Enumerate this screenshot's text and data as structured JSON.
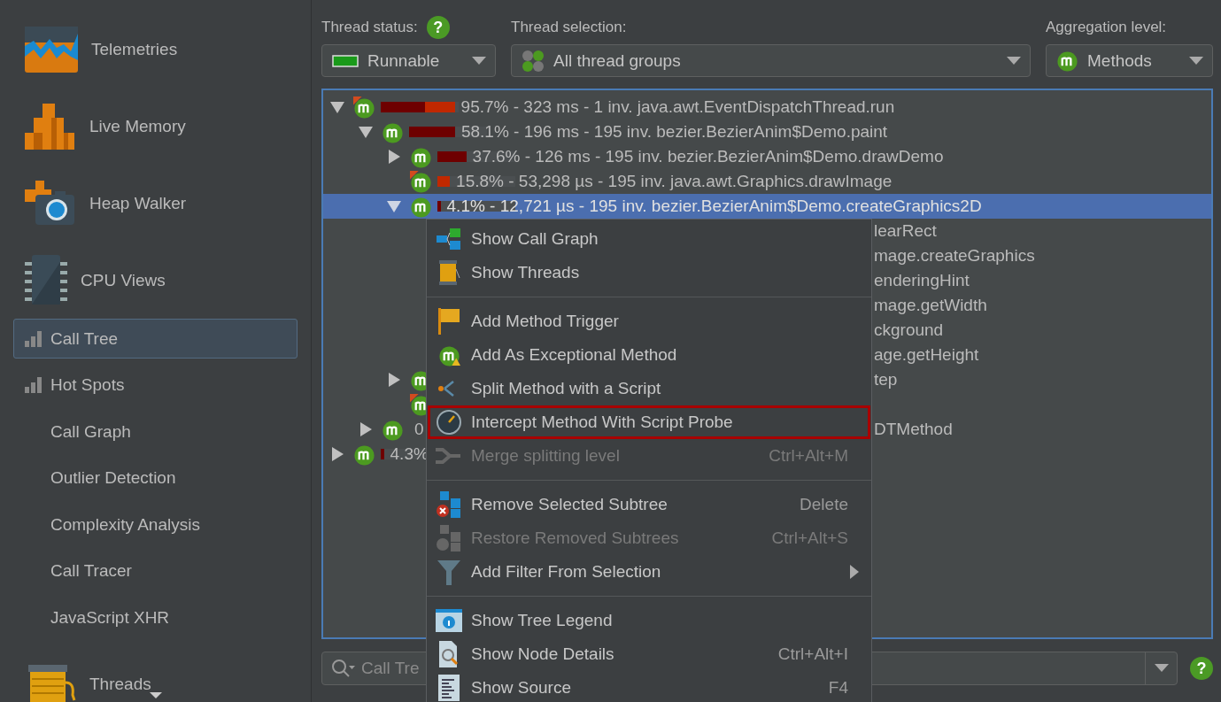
{
  "sidebar": {
    "items": [
      {
        "kind": "section",
        "label": "Telemetries",
        "selected": false
      },
      {
        "kind": "section",
        "label": "Live Memory",
        "selected": false
      },
      {
        "kind": "section",
        "label": "Heap Walker",
        "selected": false
      },
      {
        "kind": "section",
        "label": "CPU Views",
        "selected": false
      },
      {
        "kind": "view",
        "label": "Call Tree",
        "selected": true
      },
      {
        "kind": "view",
        "label": "Hot Spots",
        "selected": false
      },
      {
        "kind": "subview",
        "label": "Call Graph",
        "selected": false
      },
      {
        "kind": "subview",
        "label": "Outlier Detection",
        "selected": false
      },
      {
        "kind": "subview",
        "label": "Complexity Analysis",
        "selected": false
      },
      {
        "kind": "subview",
        "label": "Call Tracer",
        "selected": false
      },
      {
        "kind": "subview",
        "label": "JavaScript XHR",
        "selected": false
      },
      {
        "kind": "section",
        "label": "Threads",
        "selected": false
      }
    ]
  },
  "toolbar": {
    "controls": [
      {
        "label": "Thread status:",
        "help": "?",
        "value": "Runnable"
      },
      {
        "label": "Thread selection:",
        "value": "All thread groups"
      },
      {
        "label": "Aggregation level:",
        "value": "Methods"
      }
    ]
  },
  "tree": {
    "rows": [
      {
        "kind": "node",
        "expanded": true,
        "flagged": true,
        "bar": [
          {
            "level": 0.57,
            "color": "#6e0000"
          },
          {
            "level": 0.38,
            "color": "#c02800"
          }
        ],
        "text": "95.7% - 323 ms - 1 inv. java.awt.EventDispatchThread.run",
        "selected": false,
        "children": [
          {
            "kind": "node",
            "expanded": true,
            "flagged": false,
            "bar": [
              {
                "level": 0.59,
                "color": "#6e0000"
              }
            ],
            "text": "58.1% - 196 ms - 195 inv. bezier.BezierAnim$Demo.paint",
            "selected": false,
            "children": [
              {
                "kind": "node",
                "expanded": false,
                "flagged": false,
                "bar": [
                  {
                    "level": 0.37,
                    "color": "#6e0000"
                  }
                ],
                "text": "37.6% - 126 ms - 195 inv. bezier.BezierAnim$Demo.drawDemo",
                "selected": false
              },
              {
                "kind": "node",
                "flagged": true,
                "bar": [
                  {
                    "level": 0.16,
                    "color": "#c02800"
                  }
                ],
                "text": "15.8% - 53,298 µs - 195 inv. java.awt.Graphics.drawImage",
                "selected": false
              },
              {
                "kind": "node",
                "expanded": true,
                "flagged": false,
                "bar": [
                  {
                    "level": 0.04,
                    "color": "#6e0000"
                  }
                ],
                "text": "4.1% - 12,721 µs - 195 inv. bezier.BezierAnim$Demo.createGraphics2D",
                "selected": true,
                "children": [
                  {
                    "kind": "fragment",
                    "tail": "learRect"
                  },
                  {
                    "kind": "fragment",
                    "tail": "mage.createGraphics"
                  },
                  {
                    "kind": "fragment",
                    "tail": "enderingHint"
                  },
                  {
                    "kind": "fragment",
                    "tail": "mage.getWidth"
                  },
                  {
                    "kind": "fragment",
                    "tail": "ckground"
                  },
                  {
                    "kind": "fragment",
                    "tail": "age.getHeight"
                  }
                ]
              },
              {
                "kind": "node",
                "expanded": false,
                "flagged": false,
                "tail": "tep",
                "selected": false
              },
              {
                "kind": "node",
                "flagged": true,
                "selected": false
              }
            ]
          },
          {
            "kind": "node",
            "expanded": false,
            "flagged": false,
            "text": "0",
            "tail": "DTMethod",
            "selected": false
          }
        ]
      },
      {
        "kind": "node",
        "expanded": false,
        "flagged": false,
        "bar": [
          {
            "level": 0.04,
            "color": "#6e0000"
          }
        ],
        "text": "4.3%",
        "selected": false
      }
    ]
  },
  "search": {
    "placeholder": "Call Tre",
    "help": "?"
  },
  "context_menu": {
    "sections": [
      [
        {
          "label": "Show Call Graph",
          "disabled": false,
          "highlighted": false
        },
        {
          "label": "Show Threads",
          "disabled": false,
          "highlighted": false
        }
      ],
      [
        {
          "label": "Add Method Trigger",
          "disabled": false,
          "highlighted": false
        },
        {
          "label": "Add As Exceptional Method",
          "disabled": false,
          "highlighted": false
        },
        {
          "label": "Split Method with a Script",
          "disabled": false,
          "highlighted": false
        },
        {
          "label": "Intercept Method With Script Probe",
          "disabled": false,
          "highlighted": true
        },
        {
          "label": "Merge splitting level",
          "shortcut": "Ctrl+Alt+M",
          "disabled": true,
          "highlighted": false
        }
      ],
      [
        {
          "label": "Remove Selected Subtree",
          "shortcut": "Delete",
          "disabled": false,
          "highlighted": false
        },
        {
          "label": "Restore Removed Subtrees",
          "shortcut": "Ctrl+Alt+S",
          "disabled": true,
          "highlighted": false
        },
        {
          "label": "Add Filter From Selection",
          "submenu": true,
          "disabled": false,
          "highlighted": false
        }
      ],
      [
        {
          "label": "Show Tree Legend",
          "disabled": false,
          "highlighted": false
        },
        {
          "label": "Show Node Details",
          "shortcut": "Ctrl+Alt+I",
          "disabled": false,
          "highlighted": false
        },
        {
          "label": "Show Source",
          "shortcut": "F4",
          "disabled": false,
          "highlighted": false
        }
      ]
    ]
  }
}
